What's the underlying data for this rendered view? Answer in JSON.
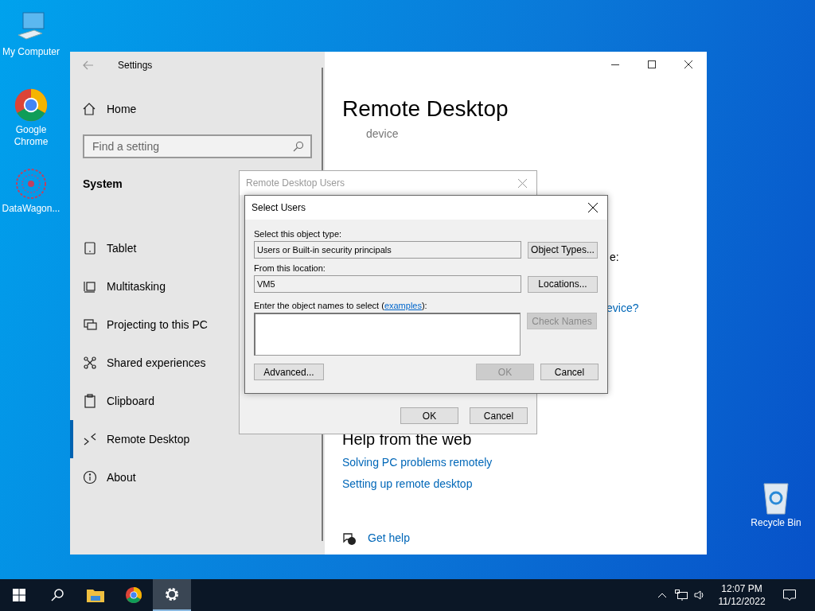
{
  "desktop_icons": [
    {
      "kind": "computer",
      "label": "My Computer"
    },
    {
      "kind": "chrome",
      "label": "Google Chrome"
    },
    {
      "kind": "app",
      "label": "DataWagon..."
    },
    {
      "kind": "recycle",
      "label": "Recycle Bin"
    }
  ],
  "settings": {
    "title": "Settings",
    "home": "Home",
    "search": {
      "placeholder": "Find a setting"
    },
    "section": "System",
    "nav": [
      {
        "kind": "tablet",
        "label": "Tablet",
        "selected": false
      },
      {
        "kind": "multitask",
        "label": "Multitasking",
        "selected": false
      },
      {
        "kind": "project",
        "label": "Projecting to this PC",
        "selected": false
      },
      {
        "kind": "shared",
        "label": "Shared experiences",
        "selected": false
      },
      {
        "kind": "clipboard",
        "label": "Clipboard",
        "selected": false
      },
      {
        "kind": "remote",
        "label": "Remote Desktop",
        "selected": true
      },
      {
        "kind": "about",
        "label": "About",
        "selected": false
      }
    ],
    "page_title": "Remote Desktop",
    "subtitle_fragment": "device",
    "fragment_colon": "e:",
    "fragment_link": "evice?",
    "help_heading": "Help from the web",
    "help_links": [
      "Solving PC problems remotely",
      "Setting up remote desktop"
    ],
    "get_help": "Get help"
  },
  "rdu_dialog": {
    "title": "Remote Desktop Users",
    "buttons": [
      "OK",
      "Cancel"
    ]
  },
  "select_users": {
    "title": "Select Users",
    "object_type_label": "Select this object type:",
    "object_type": "Users or Built-in security principals",
    "object_types_button": "Object Types...",
    "location_label": "From this location:",
    "location": "VM5",
    "locations_button": "Locations...",
    "names_label_before": "Enter the object names to select (",
    "names_label_link": "examples",
    "names_label_after": "):",
    "check_names": {
      "label": "Check Names",
      "disabled": true
    },
    "advanced": "Advanced...",
    "ok": {
      "label": "OK",
      "disabled": true
    },
    "cancel": "Cancel"
  },
  "taskbar": {
    "items": [
      {
        "kind": "start",
        "selected": false
      },
      {
        "kind": "search",
        "selected": false
      },
      {
        "kind": "explorer",
        "selected": false
      },
      {
        "kind": "chrome",
        "selected": false
      },
      {
        "kind": "settings",
        "selected": true
      }
    ],
    "time": "12:07 PM",
    "date": "11/12/2022"
  }
}
